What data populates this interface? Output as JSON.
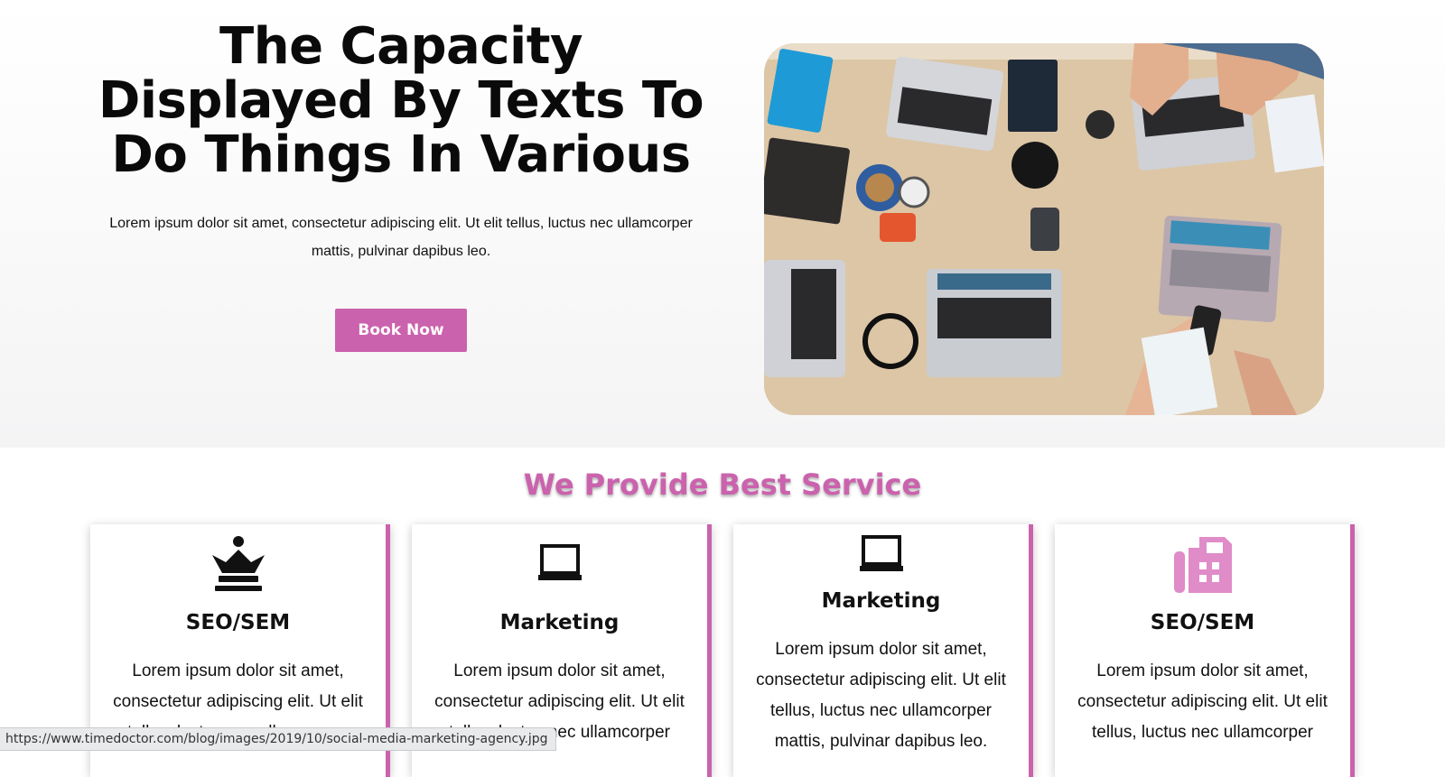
{
  "hero": {
    "title": "The Capacity Displayed By Texts To Do Things In Various",
    "text": "Lorem ipsum dolor sit amet, consectetur adipiscing elit. Ut elit tellus, luctus nec ullamcorper mattis, pulvinar dapibus leo.",
    "button_label": "Book Now",
    "image_alt": "desk-with-laptops-photo"
  },
  "services": {
    "title": "We Provide Best Service",
    "cards": [
      {
        "icon": "chess-queen-icon",
        "title": "SEO/SEM",
        "text": "Lorem ipsum dolor sit amet, consectetur adipiscing elit. Ut elit tellus, luctus nec ullamcorper"
      },
      {
        "icon": "laptop-icon",
        "title": "Marketing",
        "text": "Lorem ipsum dolor sit amet, consectetur adipiscing elit. Ut elit tellus, luctus nec ullamcorper"
      },
      {
        "icon": "laptop-icon",
        "title": "Marketing",
        "text": "Lorem ipsum dolor sit amet, consectetur adipiscing elit. Ut elit tellus, luctus nec ullamcorper mattis, pulvinar dapibus leo."
      },
      {
        "icon": "fax-icon",
        "title": "SEO/SEM",
        "text": "Lorem ipsum dolor sit amet, consectetur adipiscing elit. Ut elit tellus, luctus nec ullamcorper"
      }
    ]
  },
  "status_bar": {
    "url": "https://www.timedoctor.com/blog/images/2019/10/social-media-marketing-agency.jpg"
  },
  "colors": {
    "accent": "#cb62ad",
    "icon_pink": "#df8cc8",
    "text": "#111111"
  }
}
